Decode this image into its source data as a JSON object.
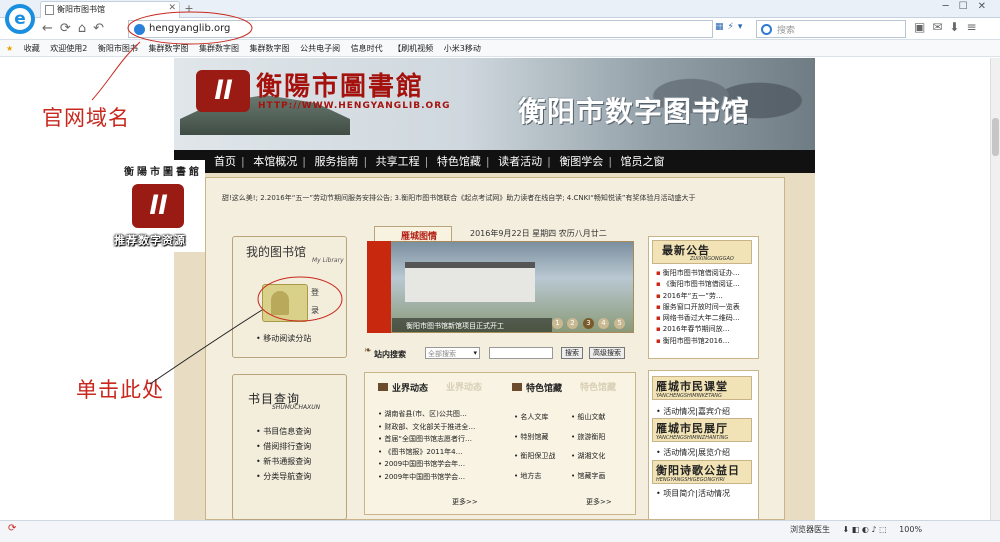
{
  "browser": {
    "tab_title": "衡阳市图书馆",
    "new_tab": "+",
    "url": "hengyanglib.org",
    "search_placeholder": "搜索",
    "favorites": [
      "收藏",
      "欢迎使用2",
      "衡阳市图书",
      "集群数字图",
      "集群数字图",
      "集群数字图",
      "公共电子阅",
      "信息时代",
      "【刷机视频",
      "小米3移动"
    ],
    "zoom": "100%",
    "status_items": [
      "浏览器医生",
      "100%"
    ]
  },
  "site": {
    "logo_text": "衡陽市圖書館",
    "logo_url": "HTTP://WWW.HENGYANGLIB.ORG",
    "banner_title": "衡阳市数字图书馆",
    "nav": [
      "首页",
      "本馆概况",
      "服务指南",
      "共享工程",
      "特色馆藏",
      "读者活动",
      "衡图学会",
      "馆员之窗"
    ],
    "ticker": "甜!这么美!;    2.2016年“五一”劳动节期间服务安排公告;    3.衡阳市图书馆联合《起点考试网》助力读者在线自学;    4.CNKI“畅知悦读”有奖体验月活动盛大于"
  },
  "mylib": {
    "title": "我的图书馆",
    "subtitle": "My Library",
    "login": "登录",
    "mobile": "移动阅读分站"
  },
  "books": {
    "title": "书目查询",
    "subtitle": "SHUMUCHAXUN",
    "items": [
      "书目信息查询",
      "借阅排行查询",
      "新书通报查询",
      "分类导航查询"
    ]
  },
  "news": {
    "tab": "雁城图情",
    "date": "2016年9月22日 星期四 农历八月廿二",
    "caption": "衡阳市图书馆新馆项目正式开工",
    "pages": [
      "1",
      "2",
      "3",
      "4",
      "5"
    ]
  },
  "sitesearch": {
    "label": "站内搜索",
    "select": "全部搜索",
    "btn_search": "搜索",
    "btn_advanced": "高级搜索"
  },
  "business": {
    "title": "业界动态",
    "ghost": "业界动态",
    "items": [
      "湖南省县(市、区)公共图…",
      "财政部、文化部关于推进全…",
      "首届“全国图书馆志愿者行…",
      "《图书馆报》2011年4…",
      "2009中国图书馆学会年…",
      "2009年中国图书馆学会…"
    ],
    "more": "更多>>"
  },
  "featured": {
    "title": "特色馆藏",
    "ghost": "特色馆藏",
    "col1": [
      "名人文库",
      "特别馆藏",
      "衡阳保卫战",
      "地方志"
    ],
    "col2": [
      "船山文献",
      "旅游衡阳",
      "湖湘文化",
      "馆藏字画"
    ],
    "more": "更多>>"
  },
  "notice": {
    "title": "最新公告",
    "subtitle": "ZUIXINGONGGAO",
    "items": [
      "衡阳市图书馆借阅证办…",
      "《衡阳市图书馆借阅证…",
      "2016年“五一”劳…",
      "服务窗口开放时间一览表",
      "网络书香过大年二维码…",
      "2016年春节期间放…",
      "衡阳市图书馆2016…"
    ]
  },
  "right": [
    {
      "title": "雁城市民课堂",
      "sub": "YANCHENGSHIMINKETANG",
      "links": "活动情况|嘉宾介绍"
    },
    {
      "title": "雁城市民展厅",
      "sub": "YANCHENGSHIMINZHANTING",
      "links": "活动情况|展览介绍"
    },
    {
      "title": "衡阳诗歌公益日",
      "sub": "HENGYANGSHIGEGONGYIRI",
      "links": "项目简介|活动情况"
    }
  ],
  "annotations": {
    "domain_label": "官网域名",
    "click_label": "单击此处",
    "seal_top": "衡陽市圖書館",
    "seal_bottom": "推荐数字资源"
  },
  "colors": {
    "accent_red": "#c8281e",
    "nav_bg": "#111111",
    "frame_bg": "#f4eede"
  }
}
